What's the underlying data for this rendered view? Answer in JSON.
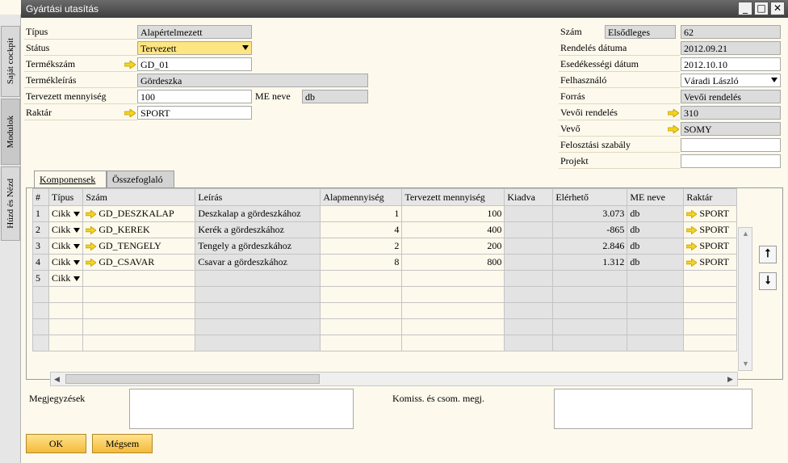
{
  "window": {
    "title": "Gyártási utasítás"
  },
  "dock": {
    "tabs": [
      "Saját cockpit",
      "Modulok",
      "Húzd és Nézd"
    ]
  },
  "left": {
    "tipus_label": "Típus",
    "tipus_value": "Alapértelmezett",
    "status_label": "Státus",
    "status_value": "Tervezett",
    "termekszam_label": "Termékszám",
    "termekszam_value": "GD_01",
    "termekleiras_label": "Termékleírás",
    "termekleiras_value": "Gördeszka",
    "mennyiseg_label": "Tervezett mennyiség",
    "mennyiseg_value": "100",
    "me_label": "ME neve",
    "me_value": "db",
    "raktar_label": "Raktár",
    "raktar_value": "SPORT"
  },
  "right": {
    "szam_label": "Szám",
    "szam_series": "Elsődleges",
    "szam_value": "62",
    "rendeles_datum_label": "Rendelés dátuma",
    "rendeles_datum_value": "2012.09.21",
    "esedekesseg_label": "Esedékességi dátum",
    "esedekesseg_value": "2012.10.10",
    "felhasznalo_label": "Felhasználó",
    "felhasznalo_value": "Váradi László",
    "forras_label": "Forrás",
    "forras_value": "Vevői rendelés",
    "vevoi_rendeles_label": "Vevői rendelés",
    "vevoi_rendeles_value": "310",
    "vevo_label": "Vevő",
    "vevo_value": "SOMY",
    "felosztasi_label": "Felosztási szabály",
    "felosztasi_value": "",
    "projekt_label": "Projekt",
    "projekt_value": ""
  },
  "tabs": [
    "Komponensek",
    "Összefoglaló"
  ],
  "grid": {
    "columns": [
      "#",
      "Típus",
      "Szám",
      "Leírás",
      "Alapmennyiség",
      "Tervezett mennyiség",
      "Kiadva",
      "Elérhető",
      "ME neve",
      "Raktár"
    ],
    "rows": [
      {
        "n": "1",
        "type": "Cikk",
        "item": "GD_DESZKALAP",
        "desc": "Deszkalap a gördeszkához",
        "base": "1",
        "planned": "100",
        "issued": "",
        "avail": "3.073",
        "uom": "db",
        "wh": "SPORT"
      },
      {
        "n": "2",
        "type": "Cikk",
        "item": "GD_KEREK",
        "desc": "Kerék a gördeszkához",
        "base": "4",
        "planned": "400",
        "issued": "",
        "avail": "-865",
        "uom": "db",
        "wh": "SPORT"
      },
      {
        "n": "3",
        "type": "Cikk",
        "item": "GD_TENGELY",
        "desc": "Tengely a gördeszkához",
        "base": "2",
        "planned": "200",
        "issued": "",
        "avail": "2.846",
        "uom": "db",
        "wh": "SPORT"
      },
      {
        "n": "4",
        "type": "Cikk",
        "item": "GD_CSAVAR",
        "desc": "Csavar a gördeszkához",
        "base": "8",
        "planned": "800",
        "issued": "",
        "avail": "1.312",
        "uom": "db",
        "wh": "SPORT"
      },
      {
        "n": "5",
        "type": "Cikk",
        "item": "",
        "desc": "",
        "base": "",
        "planned": "",
        "issued": "",
        "avail": "",
        "uom": "",
        "wh": ""
      }
    ],
    "empty_rows": 4
  },
  "bottom": {
    "megjegyzesek_label": "Megjegyzések",
    "komiss_label": "Komiss. és csom. megj."
  },
  "buttons": {
    "ok": "OK",
    "cancel": "Mégsem"
  },
  "colors": {
    "link_arrow": "#f5d320",
    "status_yellow": "#fde581",
    "button": "#f4b93a"
  }
}
